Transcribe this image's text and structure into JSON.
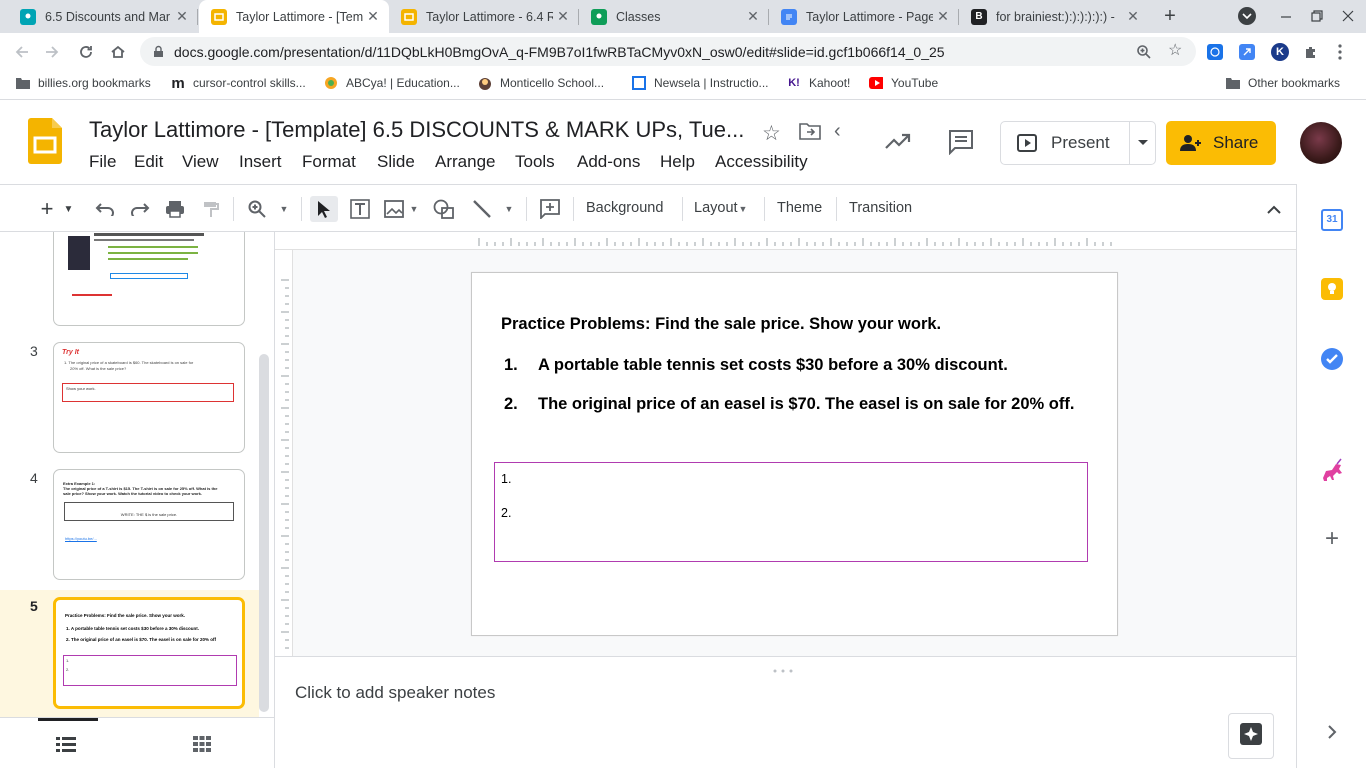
{
  "browser": {
    "tabs": [
      {
        "title": "6.5 Discounts and Mar",
        "active": false,
        "favicon_color": "#00a4b4"
      },
      {
        "title": "Taylor Lattimore - [Tem",
        "active": true,
        "favicon_color": "#f4b400"
      },
      {
        "title": "Taylor Lattimore - 6.4 R",
        "active": false,
        "favicon_color": "#f4b400"
      },
      {
        "title": "Classes",
        "active": false,
        "favicon_color": "#0f9d58"
      },
      {
        "title": "Taylor Lattimore - Page",
        "active": false,
        "favicon_color": "#4285f4"
      },
      {
        "title": "for brainiest:):):):):):) -",
        "active": false,
        "favicon_color": "#202124"
      }
    ],
    "url": "docs.google.com/presentation/d/11DQbLkH0BmgOvA_q-FM9B7oI1fwRBTaCMyv0xN_osw0/edit#slide=id.gcf1b066f14_0_25",
    "bookmarks": [
      {
        "label": "billies.org bookmarks",
        "icon": "folder-icon"
      },
      {
        "label": "cursor-control skills...",
        "icon": "m-logo-icon"
      },
      {
        "label": "ABCya! | Education...",
        "icon": "abcya-icon"
      },
      {
        "label": "Monticello School...",
        "icon": "school-icon"
      },
      {
        "label": "Newsela | Instructio...",
        "icon": "newsela-icon"
      },
      {
        "label": "Kahoot!",
        "icon": "kahoot-icon"
      },
      {
        "label": "YouTube",
        "icon": "youtube-icon"
      }
    ],
    "other_bookmarks": "Other bookmarks"
  },
  "app": {
    "title": "Taylor Lattimore - [Template] 6.5 DISCOUNTS & MARK UPs, Tue...",
    "menu": [
      "File",
      "Edit",
      "View",
      "Insert",
      "Format",
      "Slide",
      "Arrange",
      "Tools",
      "Add-ons",
      "Help",
      "Accessibility"
    ],
    "present_label": "Present",
    "share_label": "Share",
    "accent_color": "#fbbc04"
  },
  "toolbar": {
    "background": "Background",
    "layout": "Layout",
    "theme": "Theme",
    "transition": "Transition"
  },
  "filmstrip": {
    "slides": [
      {
        "number": "3",
        "title": "Try It",
        "line1": "1.   The original price of a skateboard is $60. The skateboard is on sale for",
        "line2": "20% off. What is the sale price?",
        "box": "Show your work."
      },
      {
        "number": "4",
        "title": "Extra Example 1:",
        "line1": "The original price of a T-shirt is $15. The T-shirt is on sale for 25% off. What is the",
        "line2": "sale price? Show your work. Watch the tutorial video to check your work.",
        "box": "WRITE: THE $ is the sale price.",
        "link": "https://youtu.be/..."
      },
      {
        "number": "5",
        "title": "Practice Problems: Find the sale price. Show your work.",
        "line1": "1.   A portable table tennis set costs $30 before a 30% discount.",
        "line2": "2.   The original price of an easel is $70. The easel is on sale for 20% off",
        "box1": "1.",
        "box2": "2."
      }
    ]
  },
  "slide": {
    "heading": "Practice Problems:  Find the sale price.  Show your work.",
    "items": [
      {
        "num": "1.",
        "text": "A portable table tennis set costs $30 before a 30% discount."
      },
      {
        "num": "2.",
        "text": "The original price of an easel is $70.  The easel is on sale for 20% off."
      }
    ],
    "answer_lines": [
      "1.",
      "2."
    ],
    "answer_box_color": "#b03bb0"
  },
  "notes": {
    "placeholder": "Click to add speaker notes"
  }
}
